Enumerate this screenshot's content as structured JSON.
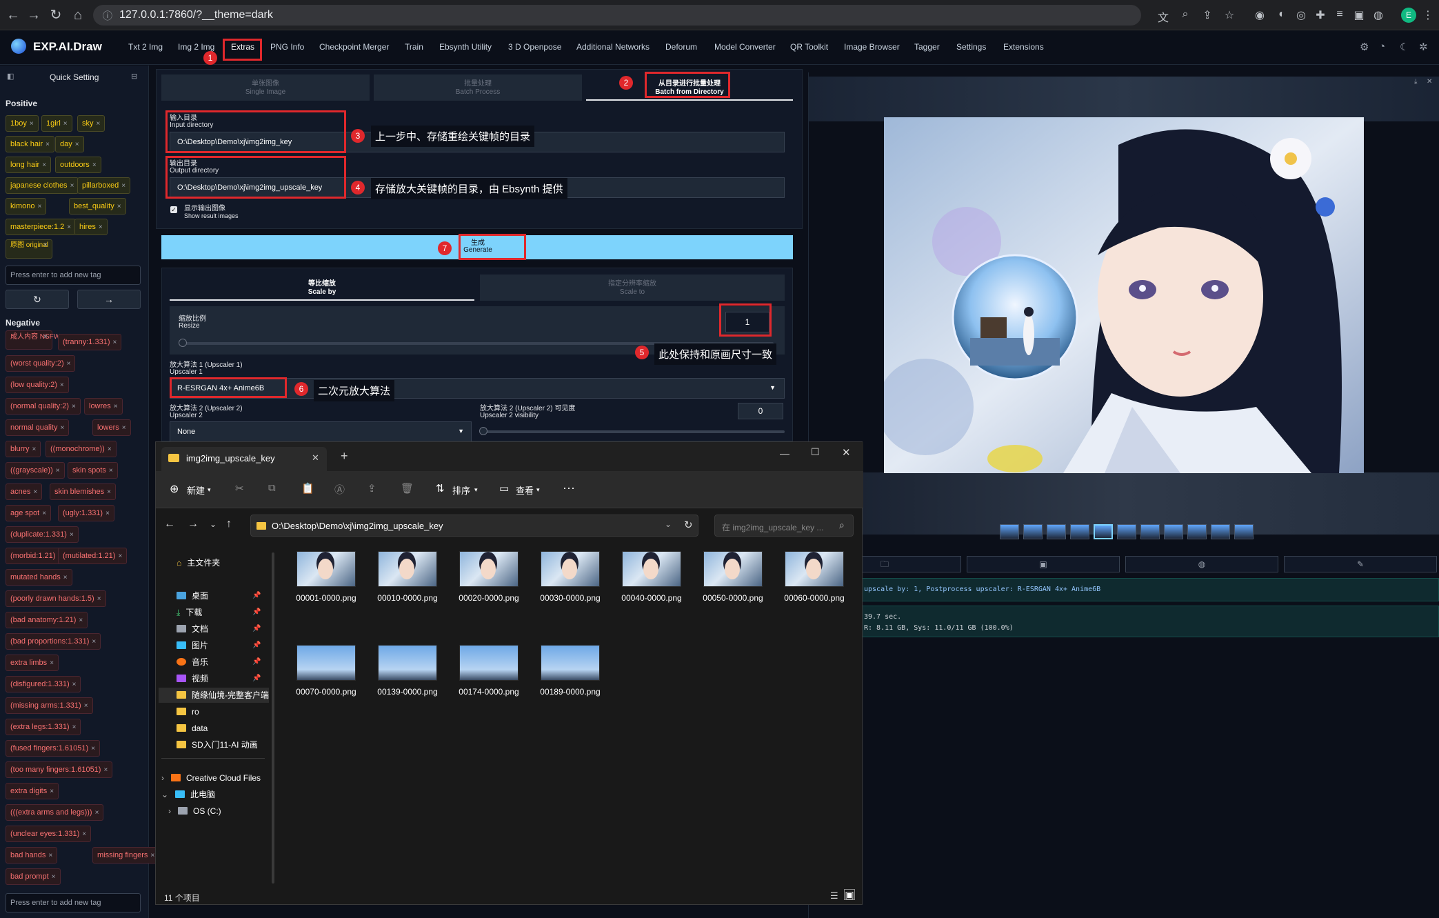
{
  "browser": {
    "url": "127.0.0.1:7860/?__theme=dark",
    "avatar_letter": "E"
  },
  "app": {
    "logo": "EXP.AI.Draw",
    "tabs": [
      "Txt 2 Img",
      "Img 2 Img",
      "Extras",
      "PNG Info",
      "Checkpoint Merger",
      "Train",
      "Ebsynth Utility",
      "3 D Openpose",
      "Additional Networks",
      "Deforum",
      "Model Converter",
      "QR Toolkit",
      "Image Browser",
      "Tagger",
      "Settings",
      "Extensions"
    ],
    "active_tab": "Extras"
  },
  "sidebar": {
    "title": "Quick Setting",
    "positive_label": "Positive",
    "positive_tags": [
      "1boy",
      "1girl",
      "sky",
      "black hair",
      "day",
      "long hair",
      "outdoors",
      "japanese clothes",
      "pillarboxed",
      "kimono",
      "best_quality",
      "masterpiece:1.2",
      "hires",
      "原图 original"
    ],
    "positive_placeholder": "Press enter to add new tag",
    "negative_label": "Negative",
    "negative_tags": [
      "成人内容 NSFW",
      "(tranny:1.331)",
      "(worst quality:2)",
      "(low quality:2)",
      "(normal quality:2)",
      "lowres",
      "normal quality",
      "lowers",
      "blurry",
      "((monochrome))",
      "((grayscale))",
      "skin spots",
      "acnes",
      "skin blemishes",
      "age spot",
      "(ugly:1.331)",
      "(duplicate:1.331)",
      "(morbid:1.21)",
      "(mutilated:1.21)",
      "mutated hands",
      "(poorly drawn hands:1.5)",
      "(bad anatomy:1.21)",
      "(bad proportions:1.331)",
      "extra limbs",
      "(disfigured:1.331)",
      "(missing arms:1.331)",
      "(extra legs:1.331)",
      "(fused fingers:1.61051)",
      "(too many fingers:1.61051)",
      "extra digits",
      "(((extra arms and legs)))",
      "(unclear eyes:1.331)",
      "bad hands",
      "missing fingers",
      "bad prompt"
    ],
    "negative_placeholder": "Press enter to add new tag"
  },
  "extras": {
    "subtabs": [
      {
        "cn": "单张图像",
        "en": "Single Image"
      },
      {
        "cn": "批量处理",
        "en": "Batch Process"
      },
      {
        "cn": "从目录进行批量处理",
        "en": "Batch from Directory"
      }
    ],
    "input_dir_label_cn": "输入目录",
    "input_dir_label_en": "Input directory",
    "input_dir_value": "O:\\Desktop\\Demo\\xj\\img2img_key",
    "output_dir_label_cn": "输出目录",
    "output_dir_label_en": "Output directory",
    "output_dir_value": "O:\\Desktop\\Demo\\xj\\img2img_upscale_key",
    "show_results_cn": "显示输出图像",
    "show_results_en": "Show result images",
    "generate_cn": "生成",
    "generate_en": "Generate",
    "scale_tabs": [
      {
        "cn": "等比缩放",
        "en": "Scale by"
      },
      {
        "cn": "指定分辨率缩放",
        "en": "Scale to"
      }
    ],
    "resize_cn": "缩放比例",
    "resize_en": "Resize",
    "resize_value": "1",
    "upscaler1_cn": "放大算法 1 (Upscaler 1)",
    "upscaler1_en": "Upscaler 1",
    "upscaler1_value": "R-ESRGAN 4x+ Anime6B",
    "upscaler2_cn": "放大算法 2 (Upscaler 2)",
    "upscaler2_en": "Upscaler 2",
    "upscaler2_value": "None",
    "visibility_cn": "放大算法 2 (Upscaler 2) 可见度",
    "visibility_en": "Upscaler 2 visibility",
    "visibility_value": "0"
  },
  "annotations": {
    "n1": "1",
    "n2": "2",
    "n3": "3",
    "n4": "4",
    "n5": "5",
    "n6": "6",
    "n7": "7",
    "a3": "上一步中、存储重绘关键帧的目录",
    "a4": "存储放大关键帧的目录，由 Ebsynth 提供",
    "a5": "此处保持和原画尺寸一致",
    "a6": "二次元放大算法"
  },
  "output": {
    "info_line": "upscale by: 1, Postprocess upscaler: R-ESRGAN 4x+ Anime6B",
    "time_line": "39.7 sec.",
    "mem_line": "R: 8.11 GB, Sys: 11.0/11 GB (100.0%)"
  },
  "explorer": {
    "tab_title": "img2img_upscale_key",
    "new_label": "新建",
    "sort_label": "排序",
    "view_label": "查看",
    "address": "O:\\Desktop\\Demo\\xj\\img2img_upscale_key",
    "search_placeholder": "在 img2img_upscale_key ...",
    "nav": [
      "主文件夹",
      "桌面",
      "下载",
      "文档",
      "图片",
      "音乐",
      "视频",
      "随缘仙境-完整客户端",
      "ro",
      "data",
      "SD入门11-AI 动画",
      "Creative Cloud Files",
      "此电脑",
      "OS (C:)"
    ],
    "files": [
      "00001-0000.png",
      "00010-0000.png",
      "00020-0000.png",
      "00030-0000.png",
      "00040-0000.png",
      "00050-0000.png",
      "00060-0000.png",
      "00070-0000.png",
      "00139-0000.png",
      "00174-0000.png",
      "00189-0000.png"
    ],
    "status": "11 个项目"
  },
  "colors": {
    "accent": "#7dd3fc",
    "annotation_red": "#e0282c",
    "bg": "#0b0f19"
  }
}
